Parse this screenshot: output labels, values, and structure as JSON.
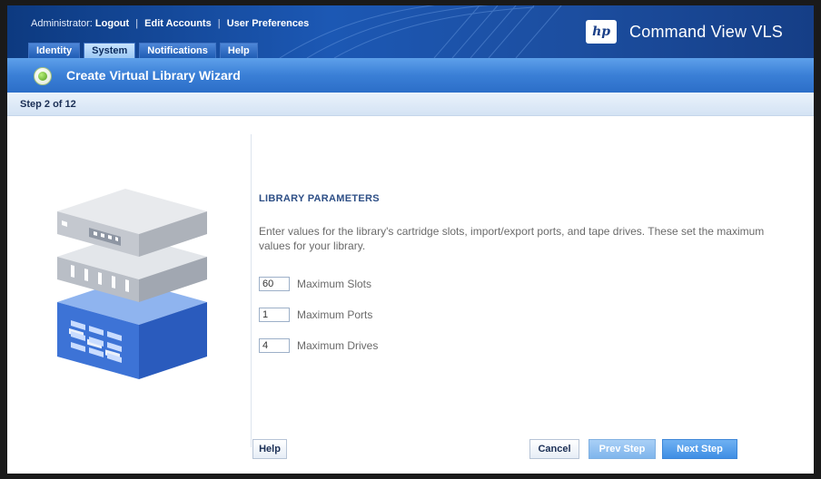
{
  "header": {
    "admin_prefix": "Administrator:",
    "logout": "Logout",
    "edit_accounts": "Edit Accounts",
    "user_preferences": "User Preferences",
    "separator": "|",
    "brand_logo_text": "hp",
    "app_title": "Command View VLS",
    "tabs": [
      {
        "label": "Identity",
        "active": false
      },
      {
        "label": "System",
        "active": true
      },
      {
        "label": "Notifications",
        "active": false
      },
      {
        "label": "Help",
        "active": false
      }
    ]
  },
  "wizard": {
    "title": "Create Virtual Library Wizard",
    "icon": "green-status-icon",
    "step": "Step 2 of 12"
  },
  "main": {
    "illustration_icon": "tape-library-stack-icon",
    "section_title": "LIBRARY PARAMETERS",
    "description": "Enter values for the library's cartridge slots, import/export ports, and tape drives. These set the maximum values for your library.",
    "fields": [
      {
        "value": "60",
        "label": "Maximum Slots"
      },
      {
        "value": "1",
        "label": "Maximum Ports"
      },
      {
        "value": "4",
        "label": "Maximum Drives"
      }
    ]
  },
  "footer": {
    "help_label": "Help",
    "cancel_label": "Cancel",
    "prev_label": "Prev Step",
    "next_label": "Next Step"
  },
  "colors": {
    "header_blue": "#1c58b4",
    "wizard_bar_blue": "#3a7fd6",
    "title_blue": "#2e4f86",
    "next_button": "#3f8ee4"
  }
}
